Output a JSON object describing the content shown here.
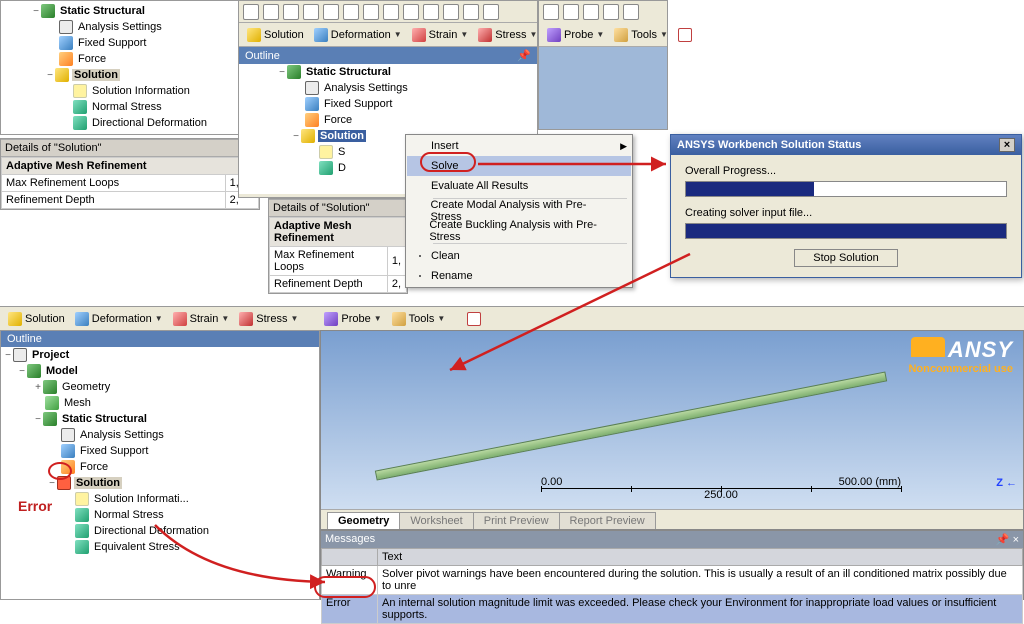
{
  "top_left_tree": {
    "root": "Static Structural",
    "items": [
      "Analysis Settings",
      "Fixed Support",
      "Force"
    ],
    "solution": "Solution",
    "solution_items": [
      "Solution Information",
      "Normal Stress",
      "Directional Deformation"
    ]
  },
  "details1": {
    "title": "Details of \"Solution\"",
    "group": "Adaptive Mesh Refinement",
    "rows": [
      {
        "k": "Max Refinement Loops",
        "v": "1,"
      },
      {
        "k": "Refinement Depth",
        "v": "2,"
      }
    ]
  },
  "mid_toolbar": {
    "items": [
      "Solution",
      "Deformation",
      "Strain",
      "Stress",
      "Probe",
      "Tools"
    ]
  },
  "outline_label": "Outline",
  "mid_tree": {
    "root": "Static Structural",
    "items": [
      "Analysis Settings",
      "Fixed Support",
      "Force"
    ],
    "solution": "Solution"
  },
  "details2": {
    "title": "Details of \"Solution\"",
    "group": "Adaptive Mesh Refinement",
    "rows": [
      {
        "k": "Max Refinement Loops",
        "v": "1,"
      },
      {
        "k": "Refinement Depth",
        "v": "2,"
      }
    ]
  },
  "context_menu": {
    "items": [
      {
        "label": "Insert",
        "arrow": true
      },
      {
        "label": "Solve",
        "hov": true
      },
      {
        "label": "Evaluate All Results"
      },
      {
        "sep": true
      },
      {
        "label": "Create Modal Analysis with Pre-Stress"
      },
      {
        "label": "Create Buckling Analysis with Pre-Stress"
      },
      {
        "sep": true
      },
      {
        "label": "Clean"
      },
      {
        "label": "Rename"
      }
    ]
  },
  "status_win": {
    "title": "ANSYS Workbench Solution Status",
    "p1_label": "Overall Progress...",
    "p1_pct": 40,
    "p2_label": "Creating solver input file...",
    "p2_pct": 100,
    "stop": "Stop Solution"
  },
  "bottom_toolbar": {
    "items": [
      "Solution",
      "Deformation",
      "Strain",
      "Stress",
      "Probe",
      "Tools"
    ]
  },
  "bottom_tree": {
    "project": "Project",
    "model": "Model",
    "geometry": "Geometry",
    "mesh": "Mesh",
    "static": "Static Structural",
    "items": [
      "Analysis Settings",
      "Fixed Support",
      "Force"
    ],
    "solution": "Solution",
    "sol_items": [
      "Solution Informati...",
      "Normal Stress",
      "Directional Deformation",
      "Equivalent Stress"
    ]
  },
  "scale": {
    "start": "0.00",
    "mid": "250.00",
    "end": "500.00 (mm)"
  },
  "logo": {
    "brand": "ANSY",
    "sub": "Noncommercial use"
  },
  "tabs": [
    "Geometry",
    "Worksheet",
    "Print Preview",
    "Report Preview"
  ],
  "messages": {
    "title": "Messages",
    "col": "Text",
    "rows": [
      {
        "type": "Warning",
        "text": "Solver pivot warnings have been encountered during the solution.  This is usually a result of an ill conditioned matrix possibly due to unre"
      },
      {
        "type": "Error",
        "text": "An internal solution magnitude limit was exceeded. Please check your Environment for inappropriate load values or insufficient supports."
      }
    ]
  },
  "error_label": "Error",
  "z_label": "Z"
}
